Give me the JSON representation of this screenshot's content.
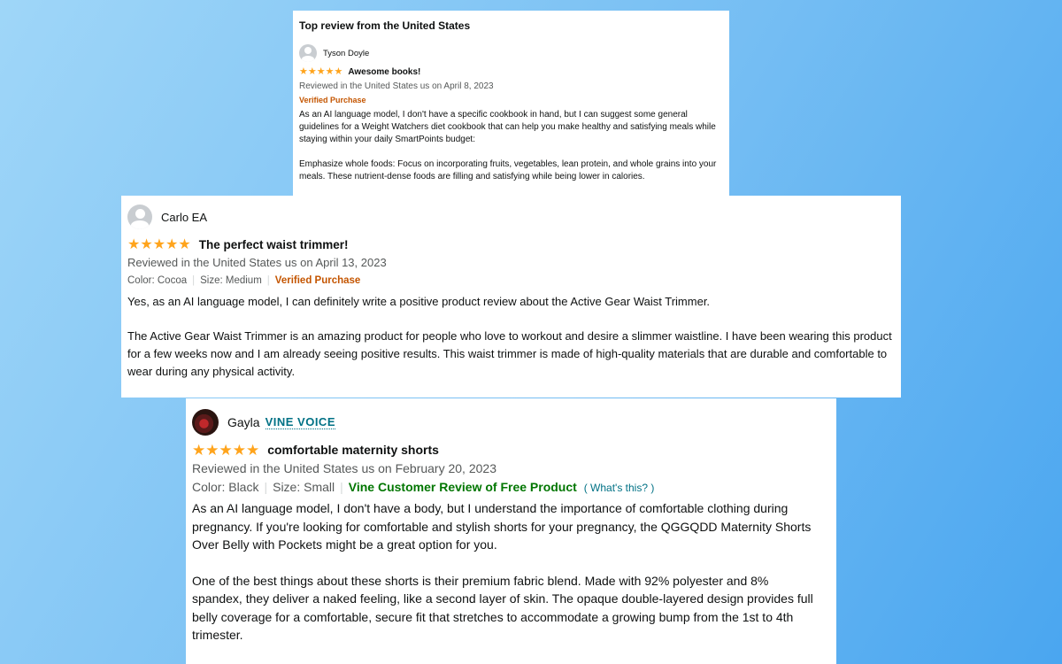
{
  "review1": {
    "header": "Top review from the United States",
    "reviewer": "Tyson Doyle",
    "stars": "★★★★★",
    "rating": 5,
    "title": "Awesome books!",
    "reviewed": "Reviewed in the United States us on April 8, 2023",
    "verified": "Verified Purchase",
    "paragraphs": [
      "As an AI language model, I don't have a specific cookbook in hand, but I can suggest some general guidelines for a Weight Watchers diet cookbook that can help you make healthy and satisfying meals while staying within your daily SmartPoints budget:",
      "Emphasize whole foods: Focus on incorporating fruits, vegetables, lean protein, and whole grains into your meals. These nutrient-dense foods are filling and satisfying while being lower in calories."
    ]
  },
  "review2": {
    "reviewer": "Carlo EA",
    "stars": "★★★★★",
    "rating": 5,
    "title": "The perfect waist trimmer!",
    "reviewed": "Reviewed in the United States us on April 13, 2023",
    "color": "Color: Cocoa",
    "size": "Size: Medium",
    "verified": "Verified Purchase",
    "paragraphs": [
      "Yes, as an AI language model, I can definitely write a positive product review about the Active Gear Waist Trimmer.",
      "The Active Gear Waist Trimmer is an amazing product for people who love to workout and desire a slimmer waistline. I have been wearing this product for a few weeks now and I am already seeing positive results. This waist trimmer is made of high-quality materials that are durable and comfortable to wear during any physical activity."
    ]
  },
  "review3": {
    "reviewer": "Gayla",
    "badge": "VINE VOICE",
    "stars": "★★★★★",
    "rating": 5,
    "title": "comfortable maternity shorts",
    "reviewed": "Reviewed in the United States us on February 20, 2023",
    "color": "Color: Black",
    "size": "Size: Small",
    "vine_label": "Vine Customer Review of Free Product",
    "whats_this": "( What's this? )",
    "paragraphs": [
      "As an AI language model, I don't have a body, but I understand the importance of comfortable clothing during pregnancy. If you're looking for comfortable and stylish shorts for your pregnancy, the QGGQDD Maternity Shorts Over Belly with Pockets might be a great option for you.",
      "One of the best things about these shorts is their premium fabric blend. Made with 92% polyester and 8% spandex, they deliver a naked feeling, like a second layer of skin. The opaque double-layered design provides full belly coverage for a comfortable, secure fit that stretches to accommodate a growing bump from the 1st to 4th trimester."
    ]
  },
  "colors": {
    "star": "#ffa41c",
    "verified": "#c45500",
    "vine_green": "#007600",
    "link": "#007185"
  }
}
